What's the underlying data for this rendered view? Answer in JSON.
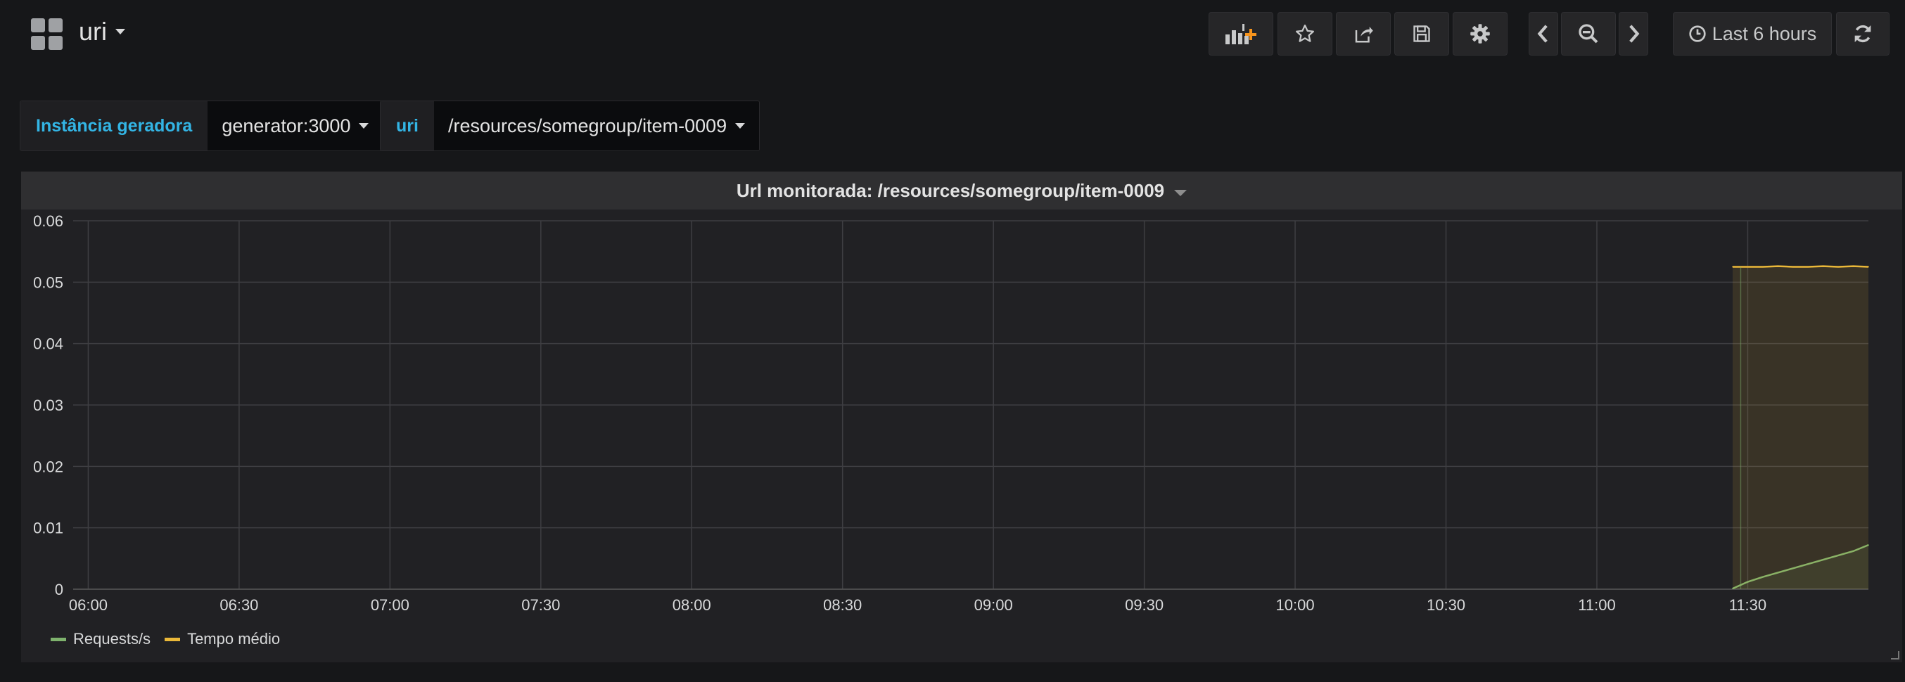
{
  "header": {
    "dashboard_title": "uri",
    "time_range_label": "Last 6 hours"
  },
  "icons": {
    "dashboard": "grid-icon",
    "add_panel": "add-panel-icon",
    "star": "star-icon",
    "share": "share-icon",
    "save": "save-icon",
    "settings": "gear-icon",
    "back": "chevron-left-icon",
    "zoom_out": "zoom-out-icon",
    "forward": "chevron-right-icon",
    "clock": "clock-icon",
    "refresh": "refresh-icon"
  },
  "variables": [
    {
      "label": "Instância geradora",
      "value": "generator:3000"
    },
    {
      "label": "uri",
      "value": "/resources/somegroup/item-0009"
    }
  ],
  "panel": {
    "title": "Url monitorada: /resources/somegroup/item-0009"
  },
  "colors": {
    "accent": "#33b5e5",
    "requests": "#7eb26d",
    "tempo": "#eab839",
    "add_panel_plus": "#f7941d"
  },
  "chart_data": {
    "type": "line",
    "title": "Url monitorada: /resources/somegroup/item-0009",
    "xlabel": "",
    "ylabel": "",
    "x_ticks": [
      "06:00",
      "06:30",
      "07:00",
      "07:30",
      "08:00",
      "08:30",
      "09:00",
      "09:30",
      "10:00",
      "10:30",
      "11:00",
      "11:30"
    ],
    "y_ticks": [
      "0",
      "0.01",
      "0.02",
      "0.03",
      "0.04",
      "0.05",
      "0.06"
    ],
    "ylim": [
      0,
      0.06
    ],
    "xlim": [
      "05:57",
      "11:54"
    ],
    "grid": true,
    "legend_position": "bottom-left",
    "series": [
      {
        "name": "Requests/s",
        "color": "#7eb26d",
        "x": [
          "11:27",
          "11:30",
          "11:33",
          "11:36",
          "11:39",
          "11:42",
          "11:45",
          "11:48",
          "11:51",
          "11:54"
        ],
        "y": [
          0.0001,
          0.0012,
          0.002,
          0.0027,
          0.0034,
          0.0041,
          0.0048,
          0.0055,
          0.0062,
          0.0072
        ]
      },
      {
        "name": "Tempo médio",
        "color": "#eab839",
        "x": [
          "11:27",
          "11:30",
          "11:33",
          "11:36",
          "11:39",
          "11:42",
          "11:45",
          "11:48",
          "11:51",
          "11:54"
        ],
        "y": [
          0.0525,
          0.0525,
          0.0525,
          0.0526,
          0.0525,
          0.0525,
          0.0526,
          0.0525,
          0.0526,
          0.0525
        ]
      }
    ]
  }
}
